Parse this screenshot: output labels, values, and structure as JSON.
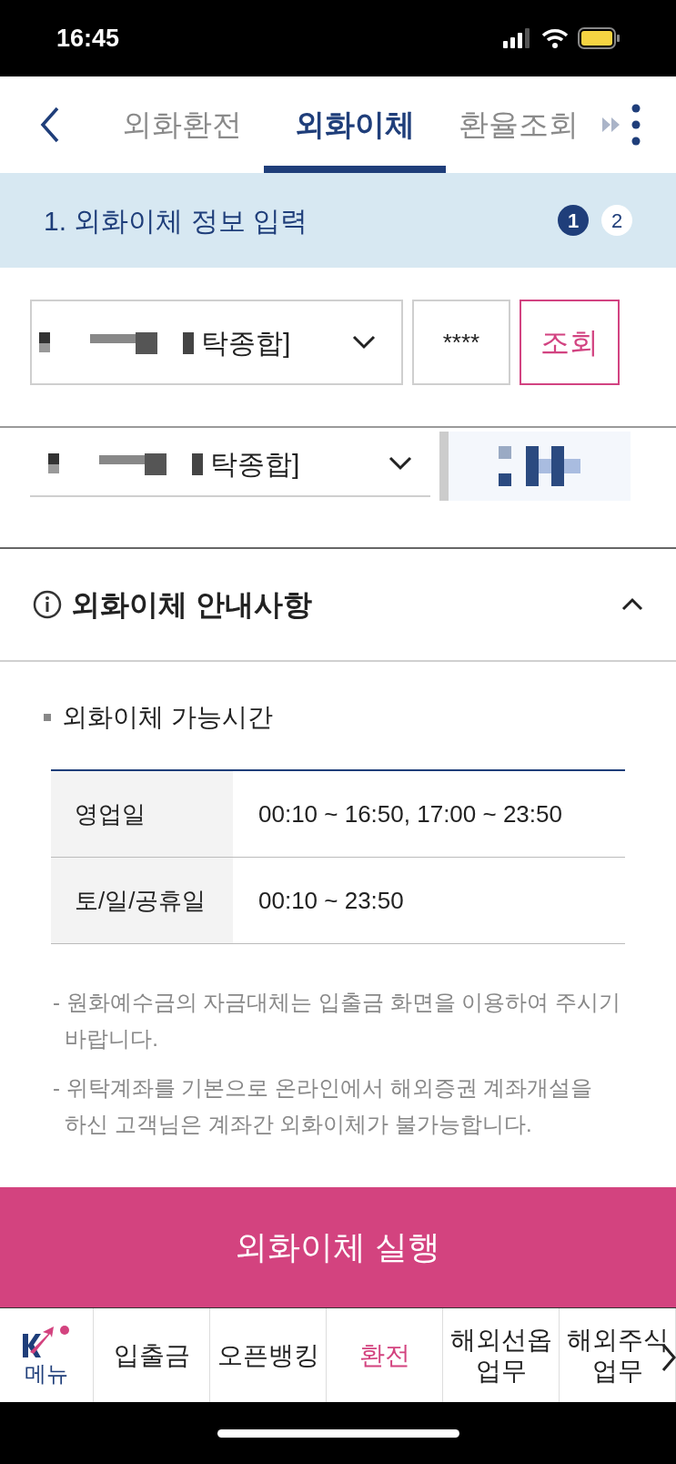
{
  "status_bar": {
    "time": "16:45"
  },
  "tabs": [
    {
      "label": "외화환전",
      "selected": false
    },
    {
      "label": "외화이체",
      "selected": true
    },
    {
      "label": "환율조회",
      "selected": false
    }
  ],
  "step_header": {
    "title": "1. 외화이체 정보 입력",
    "steps": [
      {
        "label": "1",
        "selected": true
      },
      {
        "label": "2",
        "selected": false
      }
    ]
  },
  "form": {
    "withdraw_account": "탁종합]",
    "password": "****",
    "lookup_button": "조회",
    "deposit_account": "탁종합]"
  },
  "notice": {
    "title": "외화이체 안내사항",
    "expanded": true,
    "section_title": "외화이체 가능시간",
    "rows": [
      {
        "label": "영업일",
        "value": "00:10 ~ 16:50, 17:00 ~ 23:50"
      },
      {
        "label": "토/일/공휴일",
        "value": "00:10 ~ 23:50"
      }
    ],
    "notes": [
      "- 원화예수금의 자금대체는 입출금 화면을 이용하여 주시기\n  바랍니다.",
      "- 위탁계좌를 기본으로 온라인에서 해외증권 계좌개설을\n  하신 고객님은 계좌간 외화이체가 불가능합니다."
    ]
  },
  "submit_button": "외화이체 실행",
  "bottom_nav": {
    "menu_label": "메뉴",
    "items": [
      {
        "label": "입출금",
        "selected": false
      },
      {
        "label": "오픈뱅킹",
        "selected": false
      },
      {
        "label": "환전",
        "selected": true
      },
      {
        "label": "해외선옵\n업무",
        "selected": false
      },
      {
        "label": "해외주식\n업무",
        "selected": false
      }
    ]
  }
}
